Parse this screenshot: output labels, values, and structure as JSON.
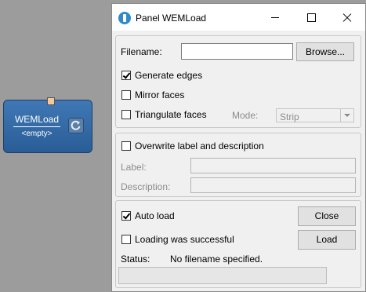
{
  "node": {
    "name": "WEMLoad",
    "status": "<empty>"
  },
  "window": {
    "title": "Panel WEMLoad"
  },
  "file": {
    "filename_label": "Filename:",
    "filename_value": "",
    "browse_label": "Browse..."
  },
  "options": {
    "generate_edges": {
      "label": "Generate edges",
      "checked": true
    },
    "mirror_faces": {
      "label": "Mirror faces",
      "checked": false
    },
    "triangulate_faces": {
      "label": "Triangulate faces",
      "checked": false
    },
    "mode_label": "Mode:",
    "mode_value": "Strip"
  },
  "labels": {
    "overwrite": {
      "label": "Overwrite label and description",
      "checked": false
    },
    "label_label": "Label:",
    "label_value": "",
    "description_label": "Description:",
    "description_value": ""
  },
  "load": {
    "auto_load": {
      "label": "Auto load",
      "checked": true
    },
    "loading_successful": {
      "label": "Loading was successful",
      "checked": false
    },
    "close_label": "Close",
    "load_label": "Load",
    "status_label": "Status:",
    "status_value": "No filename specified.",
    "progress": 0
  }
}
